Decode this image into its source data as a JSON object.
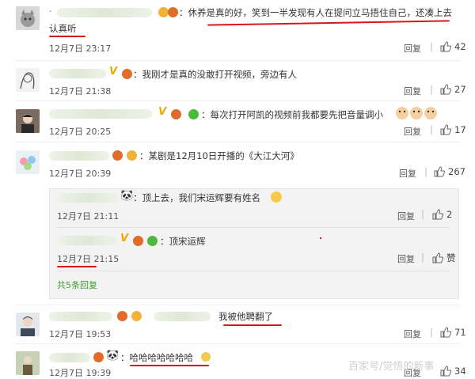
{
  "comments": [
    {
      "text": "：休养是真的好，笑到一半发现有人在提问立马捂住自己，还凑上去",
      "text2": "认真听",
      "date": "12月7日 23:17",
      "reply": "回复",
      "likes": "42"
    },
    {
      "text": "：我刚才是真的没敢打开视频，旁边有人",
      "date": "12月7日 21:38",
      "reply": "回复",
      "likes": "27"
    },
    {
      "text": "：每次打开阿凯的视频前我都要先把音量调小",
      "date": "12月7日 20:25",
      "reply": "回复",
      "likes": "17"
    },
    {
      "text": "：某剧是12月10日开播的《大江大河》",
      "date": "12月7日 20:39",
      "reply": "回复",
      "likes": "267"
    },
    {
      "text": "我被他聘翻了",
      "date": "12月7日 19:53",
      "reply": "回复",
      "likes": "71"
    },
    {
      "text": "：哈哈哈哈哈哈哈",
      "date": "12月7日 19:39",
      "reply": "回复",
      "likes": "34"
    }
  ],
  "subreplies": [
    {
      "text": "：顶上去，我们宋运辉要有姓名",
      "date": "12月7日 21:11",
      "reply": "回复",
      "likes": "2"
    },
    {
      "text": "：顶宋运辉",
      "date": "12月7日 21:15",
      "reply": "回复",
      "likes": "赞"
    }
  ],
  "more_replies": "共5条回复",
  "watermark": "百家号/觉悟的新事",
  "colors": {
    "underline": "#d8171d",
    "link": "#3f9a2e",
    "vip": "#f0a800"
  }
}
